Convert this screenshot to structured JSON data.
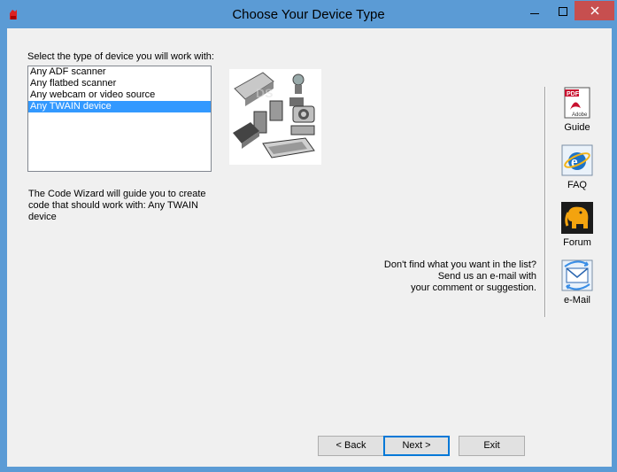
{
  "window": {
    "title": "Choose Your Device Type"
  },
  "prompt": "Select the type of device you will work with:",
  "device_list": {
    "items": [
      "Any ADF scanner",
      "Any flatbed scanner",
      "Any webcam or video source",
      "Any TWAIN device"
    ],
    "selected_index": 3
  },
  "wizard_text": "The Code Wizard will guide you to create code that should work with: Any TWAIN device",
  "help_text": {
    "line1": "Don't find what you want in the list?",
    "line2": "Send us an e-mail with",
    "line3": "your comment or suggestion."
  },
  "side_buttons": {
    "guide": {
      "label": "Guide",
      "icon": "pdf-icon"
    },
    "faq": {
      "label": "FAQ",
      "icon": "internet-explorer-icon"
    },
    "forum": {
      "label": "Forum",
      "icon": "forum-elephant-icon"
    },
    "email": {
      "label": "e-Mail",
      "icon": "email-icon"
    }
  },
  "buttons": {
    "back": "< Back",
    "next": "Next >",
    "exit": "Exit"
  },
  "colors": {
    "titlebar": "#5b9bd5",
    "selection": "#3399ff",
    "close": "#c74f4f"
  }
}
